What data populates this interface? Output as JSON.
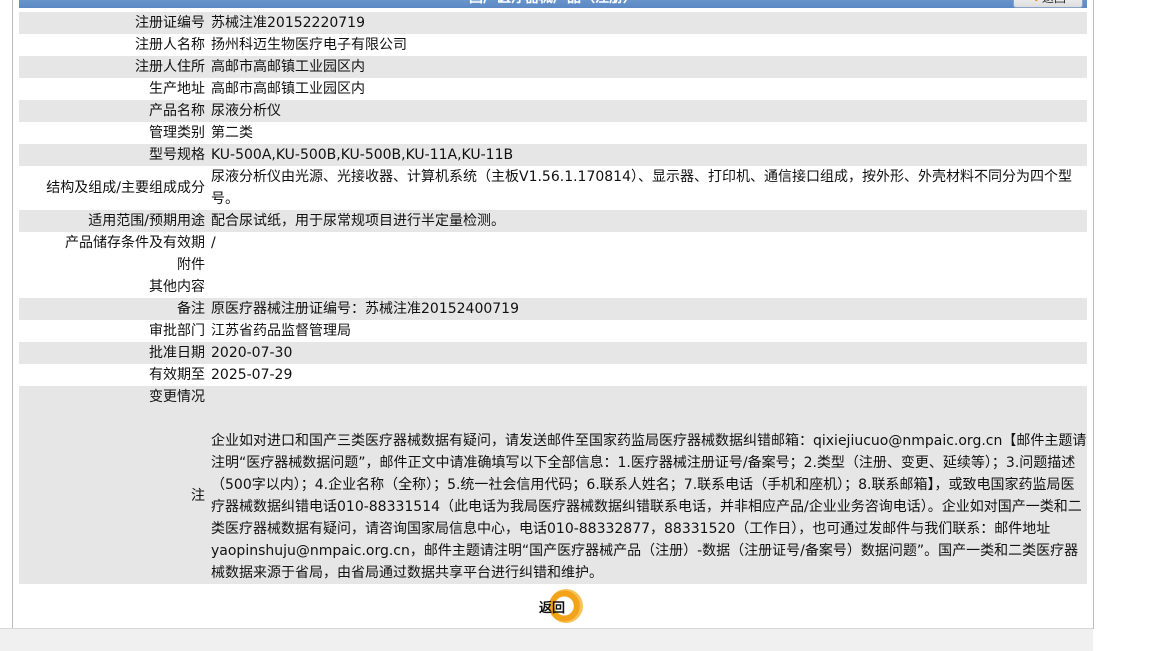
{
  "header": {
    "title": "国产医疗器械产品（注册）",
    "back_label": "返回"
  },
  "rows": [
    {
      "label": "注册证编号",
      "value": "苏械注准20152220719"
    },
    {
      "label": "注册人名称",
      "value": "扬州科迈生物医疗电子有限公司"
    },
    {
      "label": "注册人住所",
      "value": "高邮市高邮镇工业园区内"
    },
    {
      "label": "生产地址",
      "value": "高邮市高邮镇工业园区内"
    },
    {
      "label": "产品名称",
      "value": "尿液分析仪"
    },
    {
      "label": "管理类别",
      "value": "第二类"
    },
    {
      "label": "型号规格",
      "value": "KU-500A,KU-500B,KU-500B,KU-11A,KU-11B"
    },
    {
      "label": "结构及组成/主要组成成分",
      "value": "尿液分析仪由光源、光接收器、计算机系统（主板V1.56.1.170814）、显示器、打印机、通信接口组成，按外形、外壳材料不同分为四个型号。"
    },
    {
      "label": "适用范围/预期用途",
      "value": "配合尿试纸，用于尿常规项目进行半定量检测。"
    },
    {
      "label": "产品储存条件及有效期",
      "value": "/"
    },
    {
      "label": "附件",
      "value": ""
    },
    {
      "label": "其他内容",
      "value": ""
    },
    {
      "label": "备注",
      "value": "原医疗器械注册证编号：苏械注准20152400719"
    },
    {
      "label": "审批部门",
      "value": "江苏省药品监督管理局"
    },
    {
      "label": "批准日期",
      "value": "2020-07-30"
    },
    {
      "label": "有效期至",
      "value": "2025-07-29"
    },
    {
      "label": "变更情况",
      "value": ""
    }
  ],
  "note": {
    "label": "注",
    "text": "企业如对进口和国产三类医疗器械数据有疑问，请发送邮件至国家药监局医疗器械数据纠错邮箱：qixiejiucuo@nmpaic.org.cn【邮件主题请注明“医疗器械数据问题”，邮件正文中请准确填写以下全部信息：1.医疗器械注册证号/备案号；2.类型（注册、变更、延续等）；3.问题描述（500字以内）；4.企业名称（全称）；5.统一社会信用代码；6.联系人姓名；7.联系电话（手机和座机）；8.联系邮箱】，或致电国家药监局医疗器械数据纠错电话010-88331514（此电话为我局医疗器械数据纠错联系电话，并非相应产品/企业业务咨询电话）。企业如对国产一类和二类医疗器械数据有疑问，请咨询国家局信息中心，电话010-88332877，88331520（工作日），也可通过发邮件与我们联系：邮件地址yaopinshuju@nmpaic.org.cn，邮件主题请注明“国产医疗器械产品（注册）-数据（注册证号/备案号）数据问题”。国产一类和二类医疗器械数据来源于省局，由省局通过数据共享平台进行纠错和维护。"
  },
  "footer": {
    "back_label": "返回"
  }
}
